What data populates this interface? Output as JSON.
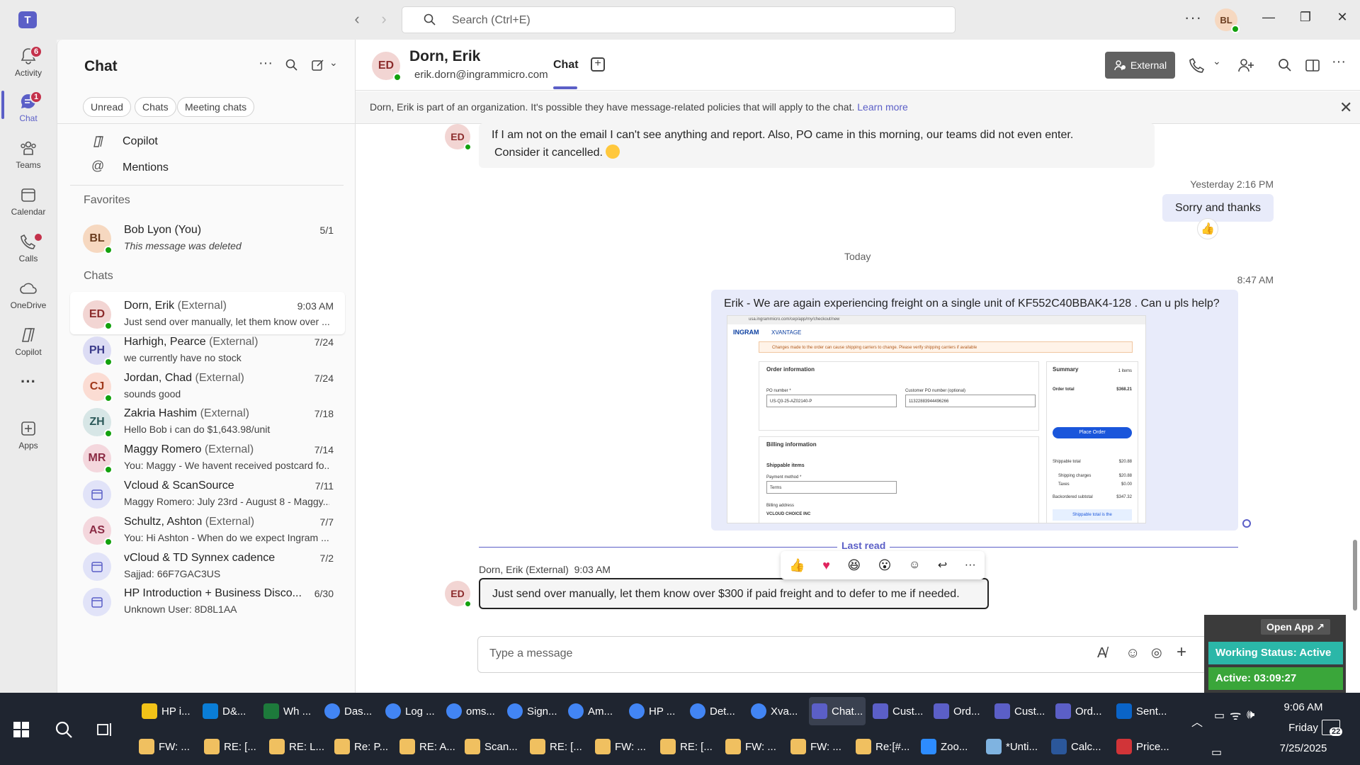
{
  "titlebar": {
    "search_placeholder": "Search (Ctrl+E)",
    "more": "···",
    "user_initials": "BL"
  },
  "rail": {
    "items": [
      {
        "label": "Activity",
        "badge": "6"
      },
      {
        "label": "Chat",
        "badge": "1"
      },
      {
        "label": "Teams"
      },
      {
        "label": "Calendar"
      },
      {
        "label": "Calls"
      },
      {
        "label": "OneDrive"
      },
      {
        "label": "Copilot"
      },
      {
        "label": "···"
      },
      {
        "label": "Apps"
      }
    ]
  },
  "chatlist": {
    "title": "Chat",
    "filters": [
      "Unread",
      "Chats",
      "Meeting chats"
    ],
    "quick": [
      "Copilot",
      "Mentions"
    ],
    "favorites_header": "Favorites",
    "chats_header": "Chats",
    "favorites": [
      {
        "initials": "BL",
        "name": "Bob Lyon (You)",
        "preview": "This message was deleted",
        "time": "5/1",
        "color": "#f6d8c0",
        "fg": "#6b3d1f"
      }
    ],
    "chats": [
      {
        "initials": "ED",
        "name": "Dorn, Erik",
        "ext": "(External)",
        "preview": "Just send over manually, let them know over ...",
        "time": "9:03 AM",
        "color": "#f2d5d3",
        "fg": "#8b2b2b"
      },
      {
        "initials": "PH",
        "name": "Harhigh, Pearce",
        "ext": "(External)",
        "preview": "we currently have no stock",
        "time": "7/24",
        "color": "#dcdcf4",
        "fg": "#3b3b8b"
      },
      {
        "initials": "CJ",
        "name": "Jordan, Chad",
        "ext": "(External)",
        "preview": "sounds good",
        "time": "7/24",
        "color": "#fbdcd3",
        "fg": "#a0381a"
      },
      {
        "initials": "ZH",
        "name": "Zakria Hashim",
        "ext": "(External)",
        "preview": "Hello Bob i can do $1,643.98/unit",
        "time": "7/18",
        "color": "#d7e6e6",
        "fg": "#2d5a5a"
      },
      {
        "initials": "MR",
        "name": "Maggy Romero",
        "ext": "(External)",
        "preview": "You: Maggy - We havent received postcard fo...",
        "time": "7/14",
        "color": "#f4d7dd",
        "fg": "#8b2b44"
      },
      {
        "initials": "",
        "name": "Vcloud & ScanSource",
        "ext": "",
        "preview": "Maggy Romero: July 23rd - August 8 - Maggy...",
        "time": "7/11",
        "color": "#e1e3f8",
        "fg": "#5b5fc7",
        "group": true
      },
      {
        "initials": "AS",
        "name": "Schultz, Ashton",
        "ext": "(External)",
        "preview": "You: Hi Ashton -  When do we expect Ingram ...",
        "time": "7/7",
        "color": "#f4d7dd",
        "fg": "#8b2b44"
      },
      {
        "initials": "",
        "name": "vCloud & TD Synnex cadence",
        "ext": "",
        "preview": "Sajjad: 66F7GAC3US",
        "time": "7/2",
        "color": "#e1e3f8",
        "fg": "#5b5fc7",
        "group": true
      },
      {
        "initials": "",
        "name": "HP Introduction + Business Disco...",
        "ext": "",
        "preview": "Unknown User: 8D8L1AA",
        "time": "6/30",
        "color": "#e1e3f8",
        "fg": "#5b5fc7",
        "group": true
      }
    ]
  },
  "conversation": {
    "initials": "ED",
    "name": "Dorn, Erik",
    "email": "erik.dorn@ingrammicro.com",
    "tab": "Chat",
    "external_label": "External",
    "banner": "Dorn, Erik is part of an organization. It's possible they have message-related policies that will apply to the chat.",
    "banner_link": "Learn more",
    "msg1_line1": "If I am not on the email I can't see anything and report.  Also, PO came in this morning, our teams did not even enter.",
    "msg1_line2": "Consider it cancelled.",
    "ts_yesterday": "Yesterday 2:16 PM",
    "msg2": "Sorry and thanks",
    "divider_today": "Today",
    "ts_847": "8:47 AM",
    "msg3": "Erik -  We are again experiencing freight on a single unit of KF552C40BBAK4-128 . Can u pls help?",
    "last_read": "Last read",
    "msg4_sender": "Dorn, Erik (External)",
    "msg4_time": "9:03 AM",
    "msg4": "Just send over manually, let them know over $300 if paid freight and to defer to me if needed.",
    "composer_placeholder": "Type a message"
  },
  "screenshot_embed": {
    "url": "usa.ingrammicro.com/cep/app/my/checkout/new",
    "brand": "INGRAM",
    "product": "XVANTAGE",
    "warning": "Changes made to the order can cause shipping carriers to change. Please verify shipping carriers if available",
    "order_info": "Order information",
    "po_label": "PO number *",
    "po_value": "US-Q3-25-AZ02140-P",
    "cust_po_label": "Customer PO number (optional)",
    "cust_po_value": "11322883944496266",
    "billing": "Billing information",
    "shippable": "Shippable items",
    "payment_label": "Payment method *",
    "payment_value": "Terms",
    "billing_addr": "Billing address",
    "billing_name": "VCLOUD CHOICE INC",
    "summary": "Summary",
    "items": "1 items",
    "order_total_label": "Order total",
    "order_total": "$368.21",
    "place_order": "Place Order",
    "shippable_total_label": "Shippable total",
    "shippable_total": "$20.88",
    "shipping_charges_label": "Shipping charges",
    "shipping_charges": "$20.88",
    "taxes_label": "Taxes",
    "taxes": "$0.00",
    "backordered_label": "Backordered subtotal",
    "backordered": "$347.32",
    "shippable_note": "Shippable total is the"
  },
  "popup": {
    "open_app": "Open App ↗",
    "status": "Working Status: Active",
    "timer": "Active: 03:09:27"
  },
  "taskbar": {
    "row1": [
      "HP i...",
      "D&...",
      "Wh ...",
      "Das...",
      "Log ...",
      "oms...",
      "Sign...",
      "Am...",
      "HP ...",
      "Det...",
      "Xva...",
      "Chat...",
      "Cust...",
      "Ord...",
      "Cust...",
      "Ord...",
      "Sent..."
    ],
    "row2": [
      "FW: ...",
      "RE: [...",
      "RE: L...",
      "Re: P...",
      "RE: A...",
      "Scan...",
      "RE: [...",
      "FW: ...",
      "RE: [...",
      "FW: ...",
      "FW: ...",
      "Re:[#...",
      "Zoo...",
      "*Unti...",
      "Calc...",
      "Price..."
    ],
    "time": "9:06 AM",
    "day": "Friday",
    "date": "7/25/2025",
    "notifications": "22"
  },
  "colors": {
    "accent": "#5b5fc7",
    "presence": "#13a10e",
    "badge": "#c4314b"
  }
}
